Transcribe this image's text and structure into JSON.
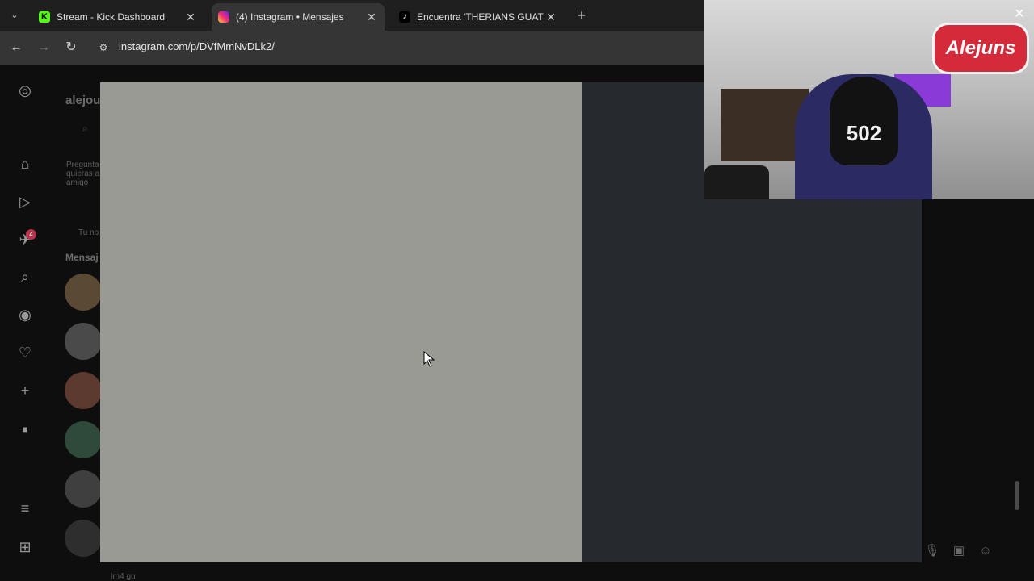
{
  "browser": {
    "tabs": [
      {
        "title": "Stream - Kick Dashboard",
        "favicon": "kick-icon",
        "active": false
      },
      {
        "title": "(4) Instagram • Mensajes",
        "favicon": "instagram-icon",
        "active": true
      },
      {
        "title": "Encuentra 'THERIANS GUATEMA",
        "favicon": "tiktok-icon",
        "active": false
      }
    ],
    "url": "instagram.com/p/DVfMmNvDLk2/"
  },
  "instagram": {
    "username_partial": "alejou",
    "notes_prompt_partial": [
      "Pregunta l",
      "quieras a",
      "amigo"
    ],
    "note_label_partial": "Tu no",
    "messages_header_partial": "Mensaj",
    "notification_count": "4",
    "footer_partial": "lrn4 gu"
  },
  "webcam": {
    "cap_text": "502",
    "logo_text": "Alejuns"
  },
  "colors": {
    "page_bg": "#0e0e0e",
    "modal_image": "#9a9a95",
    "modal_side": "#262a2e",
    "badge": "#b8324a"
  }
}
